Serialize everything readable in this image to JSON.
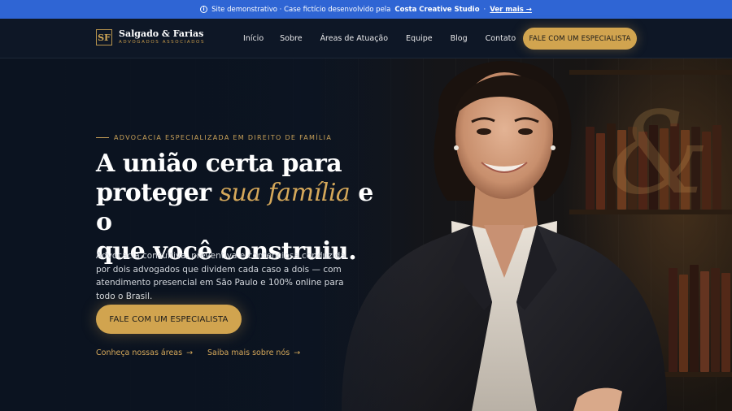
{
  "banner": {
    "icon": "info-icon",
    "text": "Site demonstrativo · Case fictício desenvolvido pela",
    "brand": "Costa Creative Studio",
    "sep": "·",
    "link": "Ver mais →"
  },
  "header": {
    "logo_name": "Salgado & Farias",
    "logo_sub": "ADVOGADOS ASSOCIADOS",
    "nav": [
      "Início",
      "Sobre",
      "Áreas de Atuação",
      "Equipe",
      "Blog",
      "Contato"
    ],
    "cta": "FALE COM UM ESPECIALISTA"
  },
  "hero": {
    "eyebrow": "ADVOCACIA ESPECIALIZADA EM DIREITO DE FAMÍLIA",
    "headline_1": "A união certa para",
    "headline_2a": "proteger",
    "headline_accent": "sua família",
    "headline_2b": "e o",
    "headline_3": "que você construiu.",
    "lead": "Advocacia consultiva, preventiva e contenciosa conduzida por dois advogados que dividem cada caso a dois — com atendimento presencial em São Paulo e 100% online para todo o Brasil.",
    "cta": "FALE COM UM ESPECIALISTA",
    "link_1": "Conheça nossas áreas",
    "link_2": "Saiba mais sobre nós",
    "arrow": "→"
  },
  "colors": {
    "banner": "#2f65d4",
    "navy": "#0e1726",
    "gold": "#d1a44f"
  }
}
